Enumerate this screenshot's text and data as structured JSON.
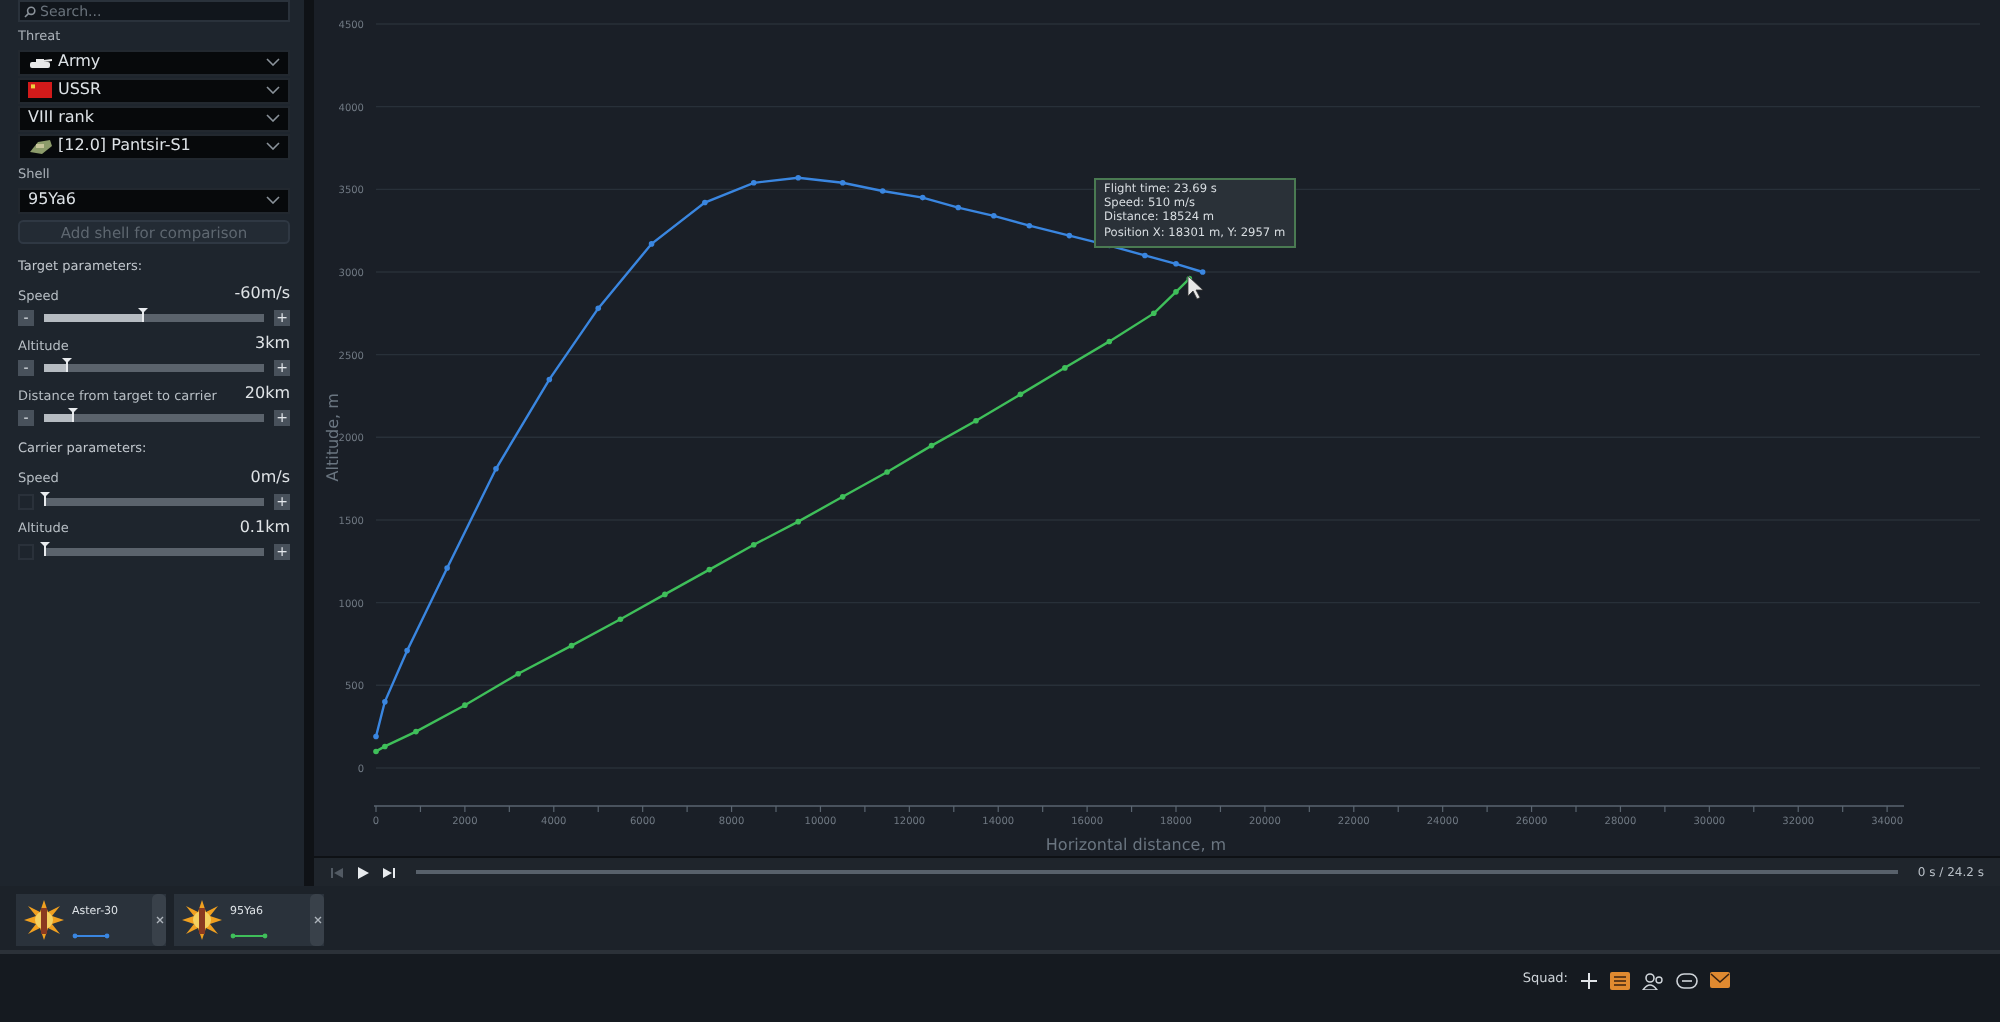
{
  "search": {
    "placeholder": "Search..."
  },
  "threat": {
    "label": "Threat",
    "selects": [
      "Army",
      "USSR",
      "VIII rank",
      "[12.0] Pantsir-S1"
    ]
  },
  "shell": {
    "label": "Shell",
    "select": "95Ya6",
    "add_button": {
      "label": "Add shell for comparison",
      "disabled": true
    }
  },
  "groups": [
    {
      "title": "Target parameters:",
      "params": [
        {
          "label": "Speed",
          "reading": "-60m/s",
          "level": 0.45,
          "minus_disabled": false,
          "minus": "-",
          "plus": "+"
        },
        {
          "label": "Altitude",
          "reading": "3km",
          "level": 0.1,
          "minus_disabled": false,
          "minus": "-",
          "plus": "+"
        },
        {
          "label": "Distance from target to carrier",
          "reading": "20km",
          "level": 0.13,
          "minus_disabled": false,
          "minus": "-",
          "plus": "+"
        }
      ]
    },
    {
      "title": "Carrier parameters:",
      "params": [
        {
          "label": "Speed",
          "reading": "0m/s",
          "level": 0,
          "minus_disabled": true,
          "plus": "+"
        },
        {
          "label": "Altitude",
          "reading": "0.1km",
          "level": 0,
          "minus_disabled": true,
          "plus": "+"
        }
      ]
    }
  ],
  "chart": {
    "chart_data": {
      "type": "line",
      "grid": true,
      "xlabel": "Horizontal distance, m",
      "ylabel": "Altitude, m",
      "xlim": [
        0,
        34200
      ],
      "ylim": [
        -230,
        4500
      ],
      "xticks": [
        0,
        2000,
        4000,
        6000,
        8000,
        10000,
        12000,
        14000,
        16000,
        18000,
        20000,
        22000,
        24000,
        26000,
        28000,
        30000,
        32000,
        34000
      ],
      "yticks": [
        0,
        500,
        1000,
        1500,
        2000,
        2500,
        3000,
        3500,
        4000,
        4500
      ],
      "series": [
        {
          "name": "Aster-30",
          "color": "#3a86e0",
          "x": [
            0,
            200,
            700,
            1600,
            2700,
            3900,
            5000,
            6200,
            7400,
            8500,
            9500,
            10500,
            11400,
            12300,
            13100,
            13900,
            14700,
            15600,
            16500,
            17300,
            18000,
            18600
          ],
          "values": [
            190,
            400,
            710,
            1210,
            1810,
            2350,
            2780,
            3170,
            3420,
            3540,
            3570,
            3540,
            3490,
            3450,
            3390,
            3340,
            3280,
            3220,
            3160,
            3100,
            3050,
            3000
          ]
        },
        {
          "name": "95Ya6",
          "color": "#3fbf5a",
          "x": [
            0,
            200,
            900,
            2000,
            3200,
            4400,
            5500,
            6500,
            7500,
            8500,
            9500,
            10500,
            11500,
            12500,
            13500,
            14500,
            15500,
            16500,
            17500,
            18000,
            18300
          ],
          "values": [
            100,
            130,
            220,
            380,
            570,
            740,
            900,
            1050,
            1200,
            1350,
            1490,
            1640,
            1790,
            1950,
            2100,
            2260,
            2420,
            2580,
            2750,
            2880,
            2960
          ]
        }
      ]
    },
    "tooltip": [
      "Flight time: 23.69 s",
      "Speed: 510 m/s",
      "Distance: 18524 m",
      "Position X: 18301 m, Y: 2957 m"
    ]
  },
  "playback": {
    "level": 0,
    "time": "0 s / 24.2 s",
    "start_disabled": true
  },
  "bottom_bar": {
    "squad_label": "Squad:"
  }
}
